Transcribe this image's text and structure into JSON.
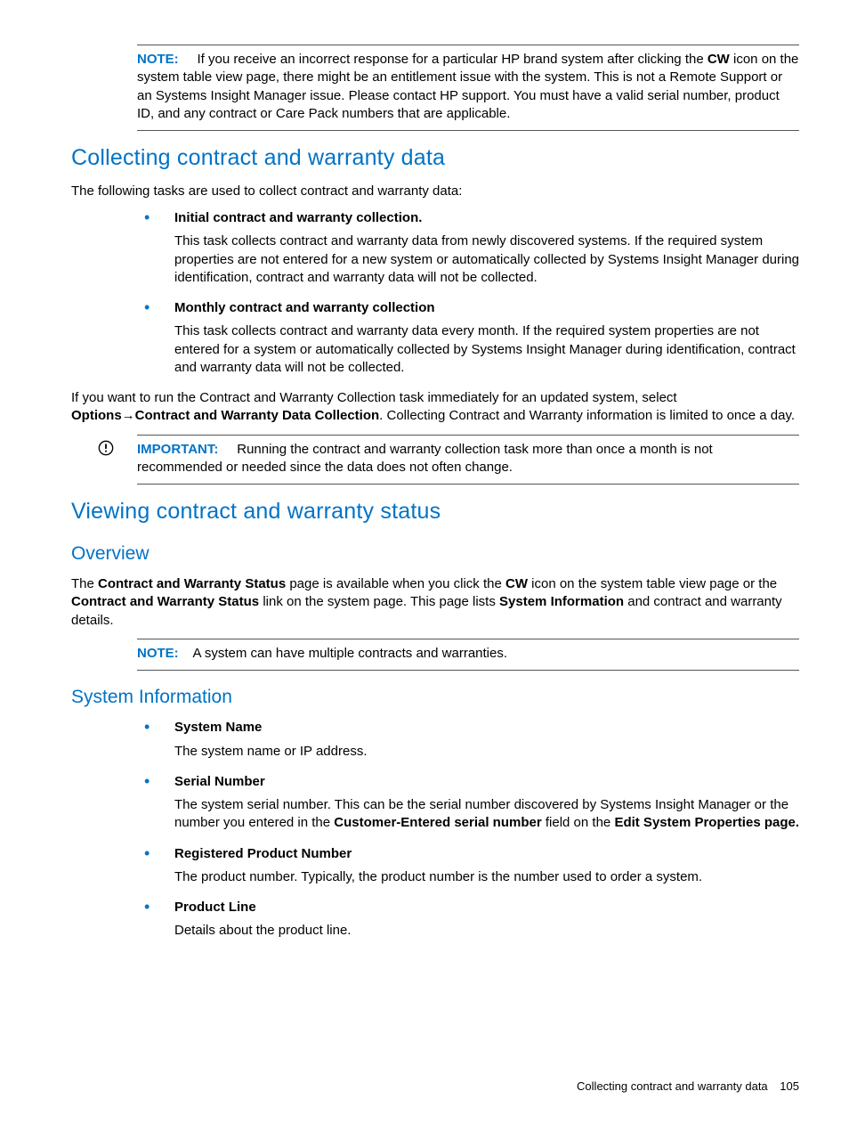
{
  "note1": {
    "label": "NOTE:",
    "t1": "If you receive an incorrect response for a particular HP brand system after clicking the ",
    "b1": "CW",
    "t2": " icon on the system table view page, there might be an entitlement issue with the system. This is not a Remote Support or an Systems Insight Manager issue. Please contact HP support. You must have a valid serial number, product ID, and any contract or Care Pack numbers that are applicable."
  },
  "sec1": {
    "title": "Collecting contract and warranty data",
    "intro": "The following tasks are used to collect contract and warranty data:",
    "items": [
      {
        "title": "Initial contract and warranty collection.",
        "desc": "This task collects contract and warranty data from newly discovered systems. If the required system properties are not entered for a new system or automatically collected by Systems Insight Manager during identification, contract and warranty data will not be collected."
      },
      {
        "title": "Monthly contract and warranty collection",
        "desc": "This task collects contract and warranty data every month. If the required system properties are not entered for a system or automatically collected by Systems Insight Manager during identification, contract and warranty data will not be collected."
      }
    ],
    "para2_t1": "If you want to run the Contract and Warranty Collection task immediately for an updated system, select ",
    "para2_b1": "Options",
    "para2_arrow": "→",
    "para2_b2": "Contract and Warranty Data Collection",
    "para2_t2": ". Collecting Contract and Warranty information is limited to once a day."
  },
  "imp1": {
    "label": "IMPORTANT:",
    "text": "Running the contract and warranty collection task more than once a month is not recommended or needed since the data does not often change."
  },
  "sec2": {
    "title": "Viewing contract and warranty status",
    "sub1": "Overview",
    "ov_t1": "The ",
    "ov_b1": "Contract and Warranty Status",
    "ov_t2": " page is available when you click the ",
    "ov_b2": "CW",
    "ov_t3": " icon on the system table view page or the ",
    "ov_b3": "Contract and Warranty Status",
    "ov_t4": " link on the system page. This page lists ",
    "ov_b4": "System Information",
    "ov_t5": " and contract and warranty details.",
    "note2": {
      "label": "NOTE:",
      "text": "A system can have multiple contracts and warranties."
    },
    "sub2": "System Information",
    "sysitems": [
      {
        "title": "System Name",
        "desc_t1": "The system name or IP address."
      },
      {
        "title": "Serial Number",
        "desc_t1": "The system serial number. This can be the serial number discovered by Systems Insight Manager or the number you entered in the ",
        "desc_b1": "Customer-Entered serial number",
        "desc_t2": " field on the ",
        "desc_b2": "Edit System Properties page."
      },
      {
        "title": "Registered Product Number",
        "desc_t1": "The product number. Typically, the product number is the number used to order a system."
      },
      {
        "title": "Product Line",
        "desc_t1": "Details about the product line."
      }
    ]
  },
  "footer": {
    "text": "Collecting contract and warranty data",
    "page": "105"
  }
}
